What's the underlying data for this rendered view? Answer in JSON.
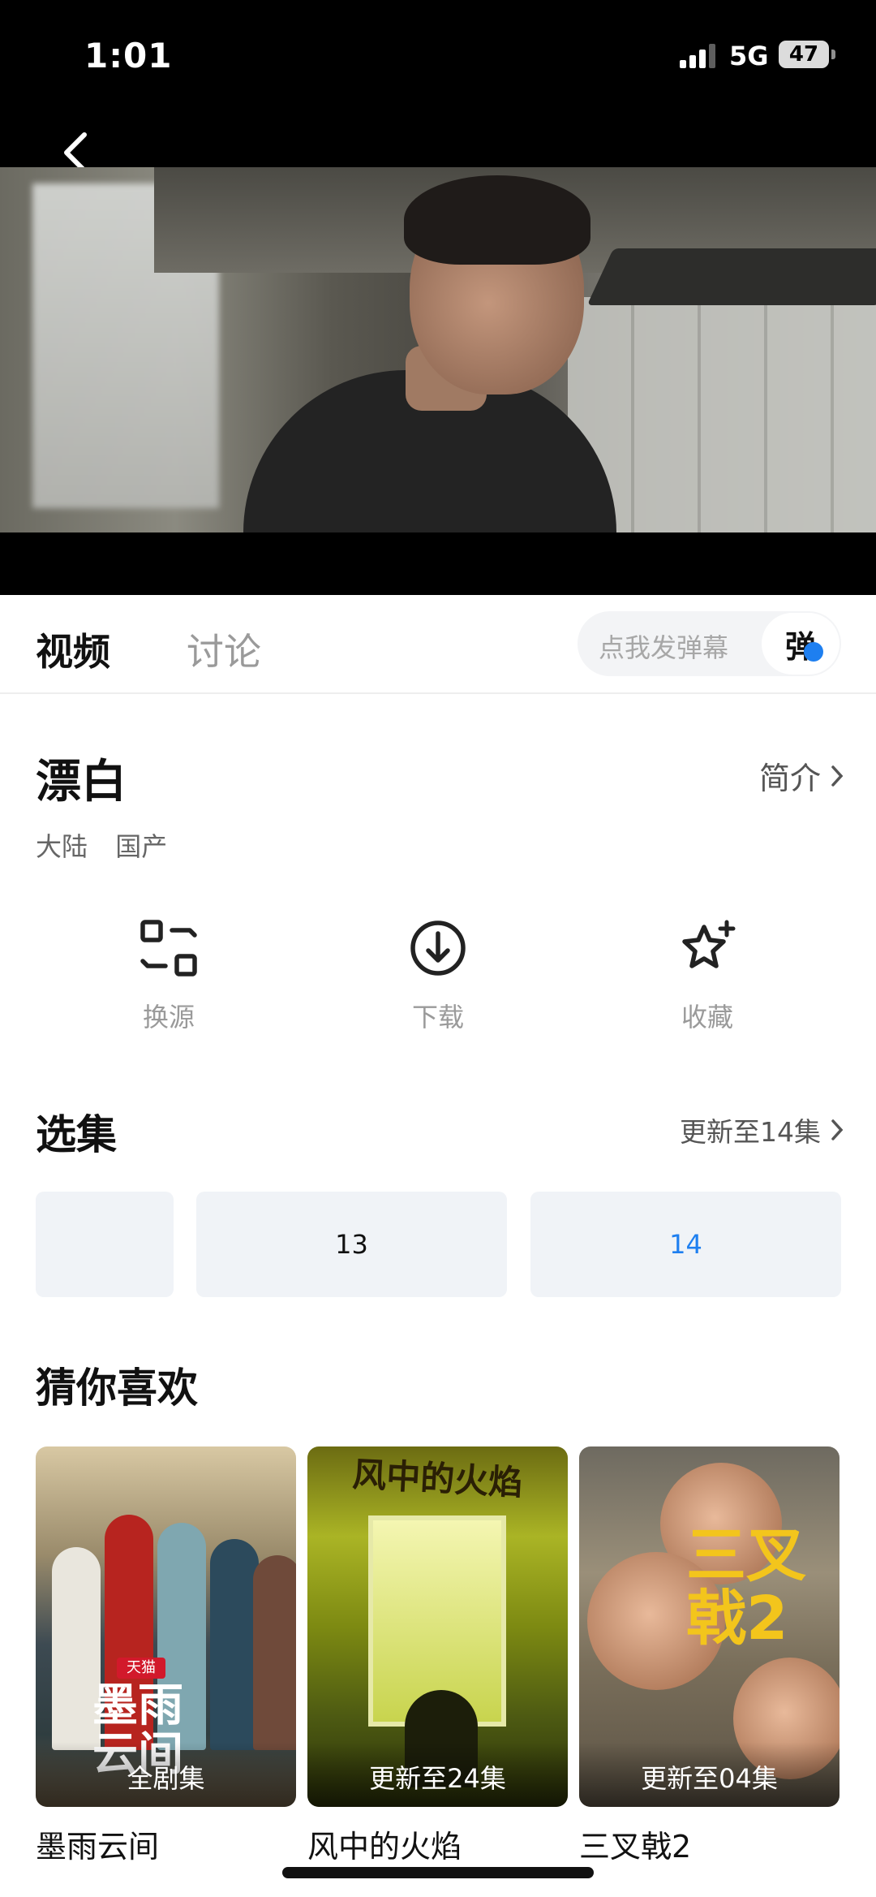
{
  "status_bar": {
    "time": "1:01",
    "network": "5G",
    "battery": "47"
  },
  "tabs": {
    "video": "视频",
    "discuss": "讨论"
  },
  "danmu": {
    "placeholder": "点我发弹幕",
    "button": "弹"
  },
  "show": {
    "title": "漂白",
    "intro_label": "简介",
    "tags": [
      "大陆",
      "国产"
    ]
  },
  "actions": [
    {
      "icon": "switch-source-icon",
      "label": "换源"
    },
    {
      "icon": "download-icon",
      "label": "下载"
    },
    {
      "icon": "star-add-icon",
      "label": "收藏"
    }
  ],
  "episodes": {
    "title": "选集",
    "update_text": "更新至14集",
    "items": [
      "",
      "13",
      "14"
    ],
    "active": "14",
    "accent": "#1e7ff0"
  },
  "recommend": {
    "title": "猜你喜欢",
    "items": [
      {
        "name": "墨雨云间",
        "badge": "全剧集",
        "poster_text": "墨雨\n云间",
        "poster_tag": "天猫"
      },
      {
        "name": "风中的火焰",
        "badge": "更新至24集",
        "poster_text": "风中的火焰"
      },
      {
        "name": "三叉戟2",
        "badge": "更新至04集",
        "poster_text": "三叉戟2"
      }
    ]
  }
}
